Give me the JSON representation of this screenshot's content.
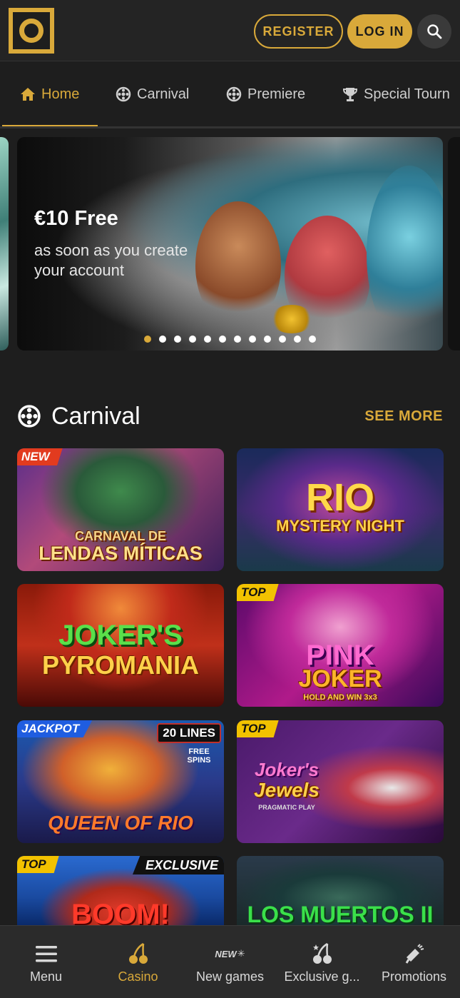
{
  "colors": {
    "accent": "#d9a93a",
    "background": "#1e1e1e",
    "header": "#242424",
    "nav": "#2b2b2b"
  },
  "header": {
    "logo_icon": "ring-logo-icon",
    "register_label": "REGISTER",
    "login_label": "LOG IN",
    "search_icon": "search-icon"
  },
  "tabs": [
    {
      "label": "Home",
      "icon": "home-icon",
      "active": true
    },
    {
      "label": "Carnival",
      "icon": "wheel-icon",
      "active": false
    },
    {
      "label": "Premiere",
      "icon": "wheel-icon",
      "active": false
    },
    {
      "label": "Special Tourn",
      "icon": "trophy-icon",
      "active": false
    }
  ],
  "banner": {
    "title": "€10 Free",
    "subtitle": "as soon as you create your account",
    "slide_count": 12,
    "active_slide": 1
  },
  "section": {
    "icon": "wheel-icon",
    "title": "Carnival",
    "see_more": "SEE MORE"
  },
  "games": [
    {
      "title_line1": "CARNAVAL DE",
      "title_line2": "LENDAS MÍTICAS",
      "badge": "NEW"
    },
    {
      "title_line1": "RIO",
      "title_line2": "MYSTERY NIGHT",
      "badge": ""
    },
    {
      "title_line1": "JOKER'S",
      "title_line2": "PYROMANIA",
      "badge": ""
    },
    {
      "title_line1": "PINK",
      "title_line2": "JOKER",
      "extra": "HOLD AND WIN 3x3",
      "badge": "TOP"
    },
    {
      "title_line1": "QUEEN OF RIO",
      "title_line2": "",
      "extra": "20 LINES",
      "extra2": "FREE SPINS",
      "badge": "JACKPOT"
    },
    {
      "title_line1": "Joker's",
      "title_line2": "Jewels",
      "extra": "PRAGMATIC PLAY",
      "badge": "TOP"
    },
    {
      "title_line1": "BOOM!",
      "title_line2": "",
      "badge": "TOP",
      "badge2": "EXCLUSIVE"
    },
    {
      "title_line1": "LOS MUERTOS II",
      "title_line2": "",
      "badge": ""
    }
  ],
  "bottom_nav": [
    {
      "label": "Menu",
      "icon": "hamburger-icon",
      "active": false
    },
    {
      "label": "Casino",
      "icon": "cherries-icon",
      "active": true
    },
    {
      "label": "New games",
      "icon": "new-badge-icon",
      "badge_text": "NEW",
      "active": false
    },
    {
      "label": "Exclusive g...",
      "icon": "cherries-star-icon",
      "active": false
    },
    {
      "label": "Promotions",
      "icon": "megaphone-icon",
      "active": false
    }
  ]
}
